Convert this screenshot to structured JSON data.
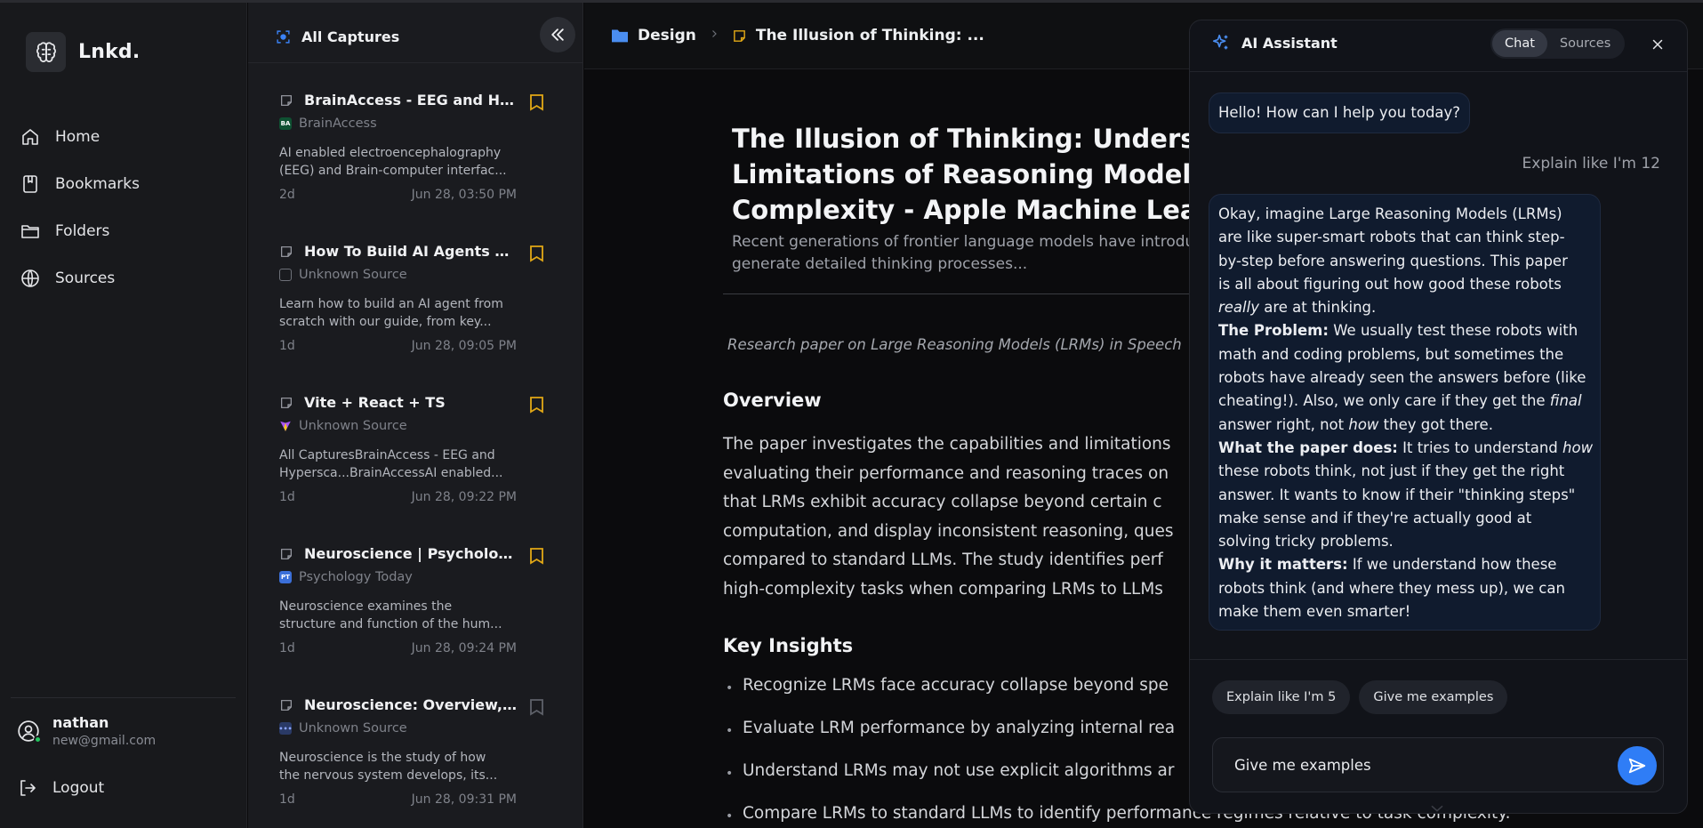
{
  "app": {
    "name": "Lnkd."
  },
  "nav": {
    "items": [
      {
        "label": "Home",
        "icon": "home-icon"
      },
      {
        "label": "Bookmarks",
        "icon": "bookmark-icon"
      },
      {
        "label": "Folders",
        "icon": "folder-icon"
      },
      {
        "label": "Sources",
        "icon": "globe-icon"
      }
    ],
    "user": {
      "name": "nathan",
      "email": "new@gmail.com"
    },
    "logout_label": "Logout"
  },
  "captures": {
    "title": "All Captures",
    "items": [
      {
        "title": "BrainAccess - EEG and Hy...",
        "source": "BrainAccess",
        "badge_text": "BA",
        "badge_color": "#0f5132",
        "desc_line1": "AI enabled electroencephalography",
        "desc_line2": "(EEG) and Brain-computer interfac...",
        "age": "2d",
        "date": "Jun 28, 03:50 PM",
        "bookmarked": true
      },
      {
        "title": "How To Build AI Agents Fro...",
        "source": "Unknown Source",
        "badge_text": "",
        "badge_color": "#2a2c31",
        "desc_line1": "Learn how to build an AI agent from",
        "desc_line2": "scratch with our guide, from key...",
        "age": "1d",
        "date": "Jun 28, 09:05 PM",
        "bookmarked": true
      },
      {
        "title": "Vite + React + TS",
        "source": "Unknown Source",
        "badge_text": "",
        "badge_color": "#8b5cf6",
        "desc_line1": "All CapturesBrainAccess - EEG and",
        "desc_line2": "Hypersca...BrainAccessAI enabled...",
        "age": "1d",
        "date": "Jun 28, 09:22 PM",
        "bookmarked": true
      },
      {
        "title": "Neuroscience | Psycholog...",
        "source": "Psychology Today",
        "badge_text": "PT",
        "badge_color": "#3b6fd8",
        "desc_line1": "Neuroscience examines the",
        "desc_line2": "structure and function of the hum...",
        "age": "1d",
        "date": "Jun 28, 09:24 PM",
        "bookmarked": true
      },
      {
        "title": "Neuroscience: Overview, h...",
        "source": "Unknown Source",
        "badge_text": "•••",
        "badge_color": "#2a3a66",
        "desc_line1": "Neuroscience is the study of how",
        "desc_line2": "the nervous system develops, its...",
        "age": "1d",
        "date": "Jun 28, 09:31 PM",
        "bookmarked": false
      }
    ]
  },
  "breadcrumb": {
    "folder": "Design",
    "page": "The Illusion of Thinking: ..."
  },
  "document": {
    "title_line1": "The Illusion of Thinking: Understand",
    "title_line2": "Limitations of Reasoning Models via",
    "title_line3": "Complexity - Apple Machine Learnin",
    "summary_line1": "Recent generations of frontier language models have introduc",
    "summary_line2": "generate detailed thinking processes...",
    "italic_note": "Research paper on Large Reasoning Models (LRMs) in Speech",
    "overview_heading": "Overview",
    "overview_lines": [
      "The paper investigates the capabilities and limitations",
      "evaluating their performance and reasoning traces on",
      "that LRMs exhibit accuracy collapse beyond certain c",
      "computation, and display inconsistent reasoning, ques",
      "compared to standard LLMs. The study identifies perf",
      "high-complexity tasks when comparing LRMs to LLMs"
    ],
    "insights_heading": "Key Insights",
    "insights": [
      "Recognize LRMs face accuracy collapse beyond spe",
      "Evaluate LRM performance by analyzing internal rea",
      "Understand LRMs may not use explicit algorithms ar",
      "Compare LRMs to standard LLMs to identify performance regimes relative to task complexity."
    ]
  },
  "assistant": {
    "title": "AI Assistant",
    "tabs": [
      "Chat",
      "Sources"
    ],
    "active_tab": "Chat",
    "greeting": "Hello! How can I help you today?",
    "user_message": "Explain like I'm 12",
    "response": {
      "intro_lines": [
        "Okay, imagine Large Reasoning Models (LRMs)",
        "are like super-smart robots that can think step-",
        "by-step before answering questions. This paper",
        "is all about figuring out how good these robots"
      ],
      "intro_em": "really",
      "intro_end": " are at thinking.",
      "problem_label": "The Problem:",
      "problem_l1": " We usually test these robots with",
      "problem_l2": "math and coding problems, but sometimes the",
      "problem_l3": "robots have already seen the answers before (like",
      "problem_l4a": "cheating!). Also, we only care if they get the ",
      "problem_em1": "final",
      "problem_l5a": "answer right, not ",
      "problem_em2": "how",
      "problem_l5b": " they got there.",
      "does_label": "What the paper does:",
      "does_l1": " It tries to understand ",
      "does_em": "how",
      "does_l2": "these robots think, not just if they get the right",
      "does_l3": "answer. It wants to know if their \"thinking steps\"",
      "does_l4": "make sense and if they're actually good at",
      "does_l5": "solving tricky problems.",
      "matters_label": "Why it matters:",
      "matters_l1": " If we understand how these",
      "matters_l2": "robots think (and where they mess up), we can",
      "matters_l3": "make them even smarter!"
    },
    "chips": [
      "Explain like I'm 5",
      "Give me examples"
    ],
    "input_value": "Give me examples"
  },
  "colors": {
    "accent": "#2f7df6",
    "bookmark": "#e2a816",
    "online": "#22c55e"
  }
}
